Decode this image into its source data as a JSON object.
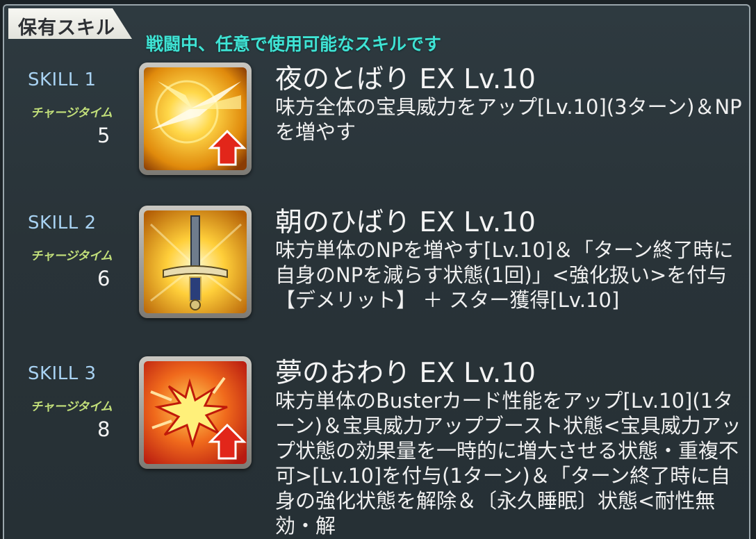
{
  "header": {
    "tab_title": "保有スキル",
    "subtitle": "戦闘中、任意で使用可能なスキルです"
  },
  "colors": {
    "subtitle": "#3fe3d4",
    "skill_label": "#a8d2f2",
    "charge_label": "#c3e07a",
    "text": "#f0f0f0",
    "panel_bg": "#2b363b"
  },
  "skills": [
    {
      "label": "SKILL 1",
      "charge_label": "チャージタイム",
      "charge_value": "5",
      "name": "夜のとばり EX Lv.10",
      "description": "味方全体の宝具威力をアップ[Lv.10](3ターン)＆NPを増やす",
      "icon": "np-up-burst-icon"
    },
    {
      "label": "SKILL 2",
      "charge_label": "チャージタイム",
      "charge_value": "6",
      "name": "朝のひばり EX Lv.10",
      "description": "味方単体のNPを増やす[Lv.10]＆「ターン終了時に自身のNPを減らす状態(1回)」<強化扱い>を付与【デメリット】 ＋ スター獲得[Lv.10]",
      "icon": "sword-icon"
    },
    {
      "label": "SKILL 3",
      "charge_label": "チャージタイム",
      "charge_value": "8",
      "name": "夢のおわり EX Lv.10",
      "description": "味方単体のBusterカード性能をアップ[Lv.10](1ターン)＆宝具威力アップブースト状態<宝具威力アップ状態の効果量を一時的に増大させる状態・重複不可>[Lv.10]を付与(1ターン)＆「ターン終了時に自身の強化状態を解除＆〔永久睡眠〕状態<耐性無効・解",
      "icon": "buster-up-burst-icon"
    }
  ]
}
